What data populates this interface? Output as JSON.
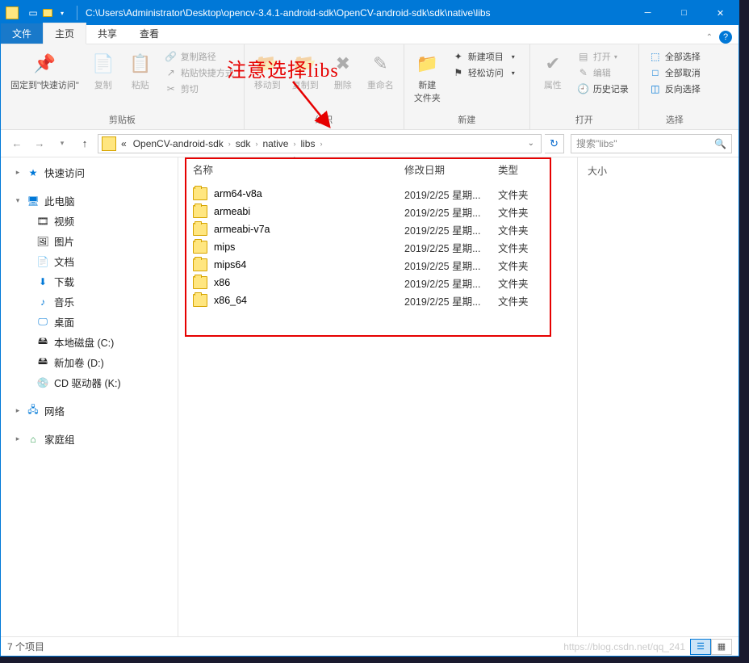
{
  "titlebar": {
    "path": "C:\\Users\\Administrator\\Desktop\\opencv-3.4.1-android-sdk\\OpenCV-android-sdk\\sdk\\native\\libs"
  },
  "menu": {
    "file": "文件",
    "home": "主页",
    "share": "共享",
    "view": "查看"
  },
  "ribbon": {
    "pin": "固定到\"快速访问\"",
    "copy": "复制",
    "paste": "粘贴",
    "copypath": "复制路径",
    "pasteshortcut": "粘贴快捷方式",
    "cut": "剪切",
    "g_clipboard": "剪贴板",
    "moveto": "移动到",
    "copyto": "复制到",
    "delete": "删除",
    "rename": "重命名",
    "g_organize": "组织",
    "newfolder": "新建\n文件夹",
    "newitem": "新建项目",
    "easyaccess": "轻松访问",
    "g_new": "新建",
    "properties": "属性",
    "open": "打开",
    "edit": "编辑",
    "history": "历史记录",
    "g_open": "打开",
    "selectall": "全部选择",
    "selectnone": "全部取消",
    "invert": "反向选择",
    "g_select": "选择"
  },
  "annotation": "注意选择libs",
  "breadcrumb": {
    "items": [
      "«",
      "OpenCV-android-sdk",
      "sdk",
      "native",
      "libs"
    ]
  },
  "search": {
    "placeholder": "搜索\"libs\""
  },
  "sidebar": {
    "quickaccess": "快速访问",
    "thispc": "此电脑",
    "videos": "视频",
    "pictures": "图片",
    "documents": "文档",
    "downloads": "下载",
    "music": "音乐",
    "desktop": "桌面",
    "cdrive": "本地磁盘 (C:)",
    "ddrive": "新加卷 (D:)",
    "cddrive": "CD 驱动器 (K:)",
    "network": "网络",
    "homegroup": "家庭组"
  },
  "columns": {
    "name": "名称",
    "date": "修改日期",
    "type": "类型",
    "size": "大小"
  },
  "files": [
    {
      "name": "arm64-v8a",
      "date": "2019/2/25 星期...",
      "type": "文件夹"
    },
    {
      "name": "armeabi",
      "date": "2019/2/25 星期...",
      "type": "文件夹"
    },
    {
      "name": "armeabi-v7a",
      "date": "2019/2/25 星期...",
      "type": "文件夹"
    },
    {
      "name": "mips",
      "date": "2019/2/25 星期...",
      "type": "文件夹"
    },
    {
      "name": "mips64",
      "date": "2019/2/25 星期...",
      "type": "文件夹"
    },
    {
      "name": "x86",
      "date": "2019/2/25 星期...",
      "type": "文件夹"
    },
    {
      "name": "x86_64",
      "date": "2019/2/25 星期...",
      "type": "文件夹"
    }
  ],
  "status": {
    "count": "7 个项目",
    "watermark": "https://blog.csdn.net/qq_241"
  }
}
